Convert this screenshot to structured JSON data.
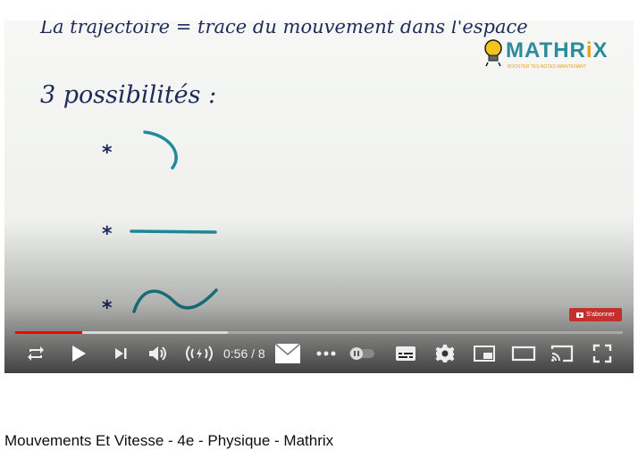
{
  "video": {
    "title": "Mouvements Et Vitesse - 4e - Physique - Mathrix",
    "time_display": "0:56 / 8",
    "progress": {
      "played_fraction": 0.11,
      "loaded_fraction": 0.35
    }
  },
  "overlay": {
    "logo_word_1": "MATHR",
    "logo_word_2": "i",
    "logo_word_3": "X",
    "logo_tagline": "BOOSTER TES NOTES MAINTENANT",
    "subscribe_label": "S'abonner"
  },
  "board": {
    "line_1": "La trajectoire = trace du mouvement dans l'espace",
    "heading": "3 possibilités :",
    "bullet": "*"
  },
  "colors": {
    "ink": "#1f2a5a",
    "drawing": "#1e8c9a",
    "progress_played": "#ff0000",
    "subscribe_bg": "#c4302b"
  },
  "icons": [
    "loop-icon",
    "play-icon",
    "next-icon",
    "volume-icon",
    "autoplay-icon",
    "mail-icon",
    "more-icon",
    "toggle-icon",
    "subtitles-icon",
    "settings-icon",
    "miniplayer-icon",
    "theater-icon",
    "cast-icon",
    "fullscreen-icon"
  ]
}
